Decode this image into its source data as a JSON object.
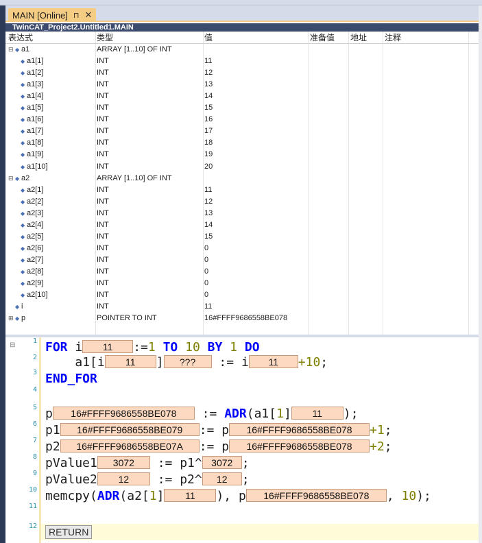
{
  "window": {
    "tab_label": "MAIN [Online]",
    "pin_glyph": "⊓",
    "close_glyph": "✕",
    "path": "TwinCAT_Project2.Untitled1.MAIN"
  },
  "watch": {
    "headers": {
      "expr": "表达式",
      "type": "类型",
      "value": "值",
      "prepared": "准备值",
      "address": "地址",
      "comment": "注释"
    },
    "rows": [
      {
        "expr": "a1",
        "type": "ARRAY [1..10] OF INT",
        "value": "",
        "expandable": true
      },
      {
        "expr": "a1[1]",
        "type": "INT",
        "value": "11"
      },
      {
        "expr": "a1[2]",
        "type": "INT",
        "value": "12"
      },
      {
        "expr": "a1[3]",
        "type": "INT",
        "value": "13"
      },
      {
        "expr": "a1[4]",
        "type": "INT",
        "value": "14"
      },
      {
        "expr": "a1[5]",
        "type": "INT",
        "value": "15"
      },
      {
        "expr": "a1[6]",
        "type": "INT",
        "value": "16"
      },
      {
        "expr": "a1[7]",
        "type": "INT",
        "value": "17"
      },
      {
        "expr": "a1[8]",
        "type": "INT",
        "value": "18"
      },
      {
        "expr": "a1[9]",
        "type": "INT",
        "value": "19"
      },
      {
        "expr": "a1[10]",
        "type": "INT",
        "value": "20"
      },
      {
        "expr": "a2",
        "type": "ARRAY [1..10] OF INT",
        "value": "",
        "expandable": true
      },
      {
        "expr": "a2[1]",
        "type": "INT",
        "value": "11"
      },
      {
        "expr": "a2[2]",
        "type": "INT",
        "value": "12"
      },
      {
        "expr": "a2[3]",
        "type": "INT",
        "value": "13"
      },
      {
        "expr": "a2[4]",
        "type": "INT",
        "value": "14"
      },
      {
        "expr": "a2[5]",
        "type": "INT",
        "value": "15"
      },
      {
        "expr": "a2[6]",
        "type": "INT",
        "value": "0"
      },
      {
        "expr": "a2[7]",
        "type": "INT",
        "value": "0"
      },
      {
        "expr": "a2[8]",
        "type": "INT",
        "value": "0"
      },
      {
        "expr": "a2[9]",
        "type": "INT",
        "value": "0"
      },
      {
        "expr": "a2[10]",
        "type": "INT",
        "value": "0"
      },
      {
        "expr": "i",
        "type": "INT",
        "value": "11"
      },
      {
        "expr": "p",
        "type": "POINTER TO INT",
        "value": "16#FFFF9686558BE078",
        "expandable": true,
        "collapsed": true
      }
    ]
  },
  "code": {
    "line_numbers": [
      "1",
      "2",
      "3",
      "4",
      "5",
      "6",
      "7",
      "8",
      "9",
      "10",
      "11",
      "12"
    ],
    "kw": {
      "for": "FOR",
      "to": "TO",
      "by": "BY",
      "do": "DO",
      "end_for": "END_FOR",
      "adr": "ADR"
    },
    "idents": {
      "i": "i",
      "a1": "a1",
      "p": "p",
      "p1": "p1",
      "p2": "p2",
      "pValue1": "pValue1",
      "pValue2": "pValue2",
      "memcpy": "memcpy",
      "a2": "a2"
    },
    "lits": {
      "one": "1",
      "ten": "10",
      "plus_ten": "+10",
      "plus_one": "+1",
      "plus_two": "+2"
    },
    "inline": {
      "l1_i": "11",
      "l2_i": "11",
      "l2_elem": "???",
      "l2_rhs_i": "11",
      "l6_p": "16#FFFF9686558BE078",
      "l6_a1": "11",
      "l7_p1": "16#FFFF9686558BE079",
      "l7_p": "16#FFFF9686558BE078",
      "l8_p2": "16#FFFF9686558BE07A",
      "l8_p": "16#FFFF9686558BE078",
      "l9_pv1": "3072",
      "l9_deref": "3072",
      "l10_pv2": "12",
      "l10_deref": "12",
      "l11_a2": "11",
      "l11_p": "16#FFFF9686558BE078"
    },
    "return_label": "RETURN"
  }
}
